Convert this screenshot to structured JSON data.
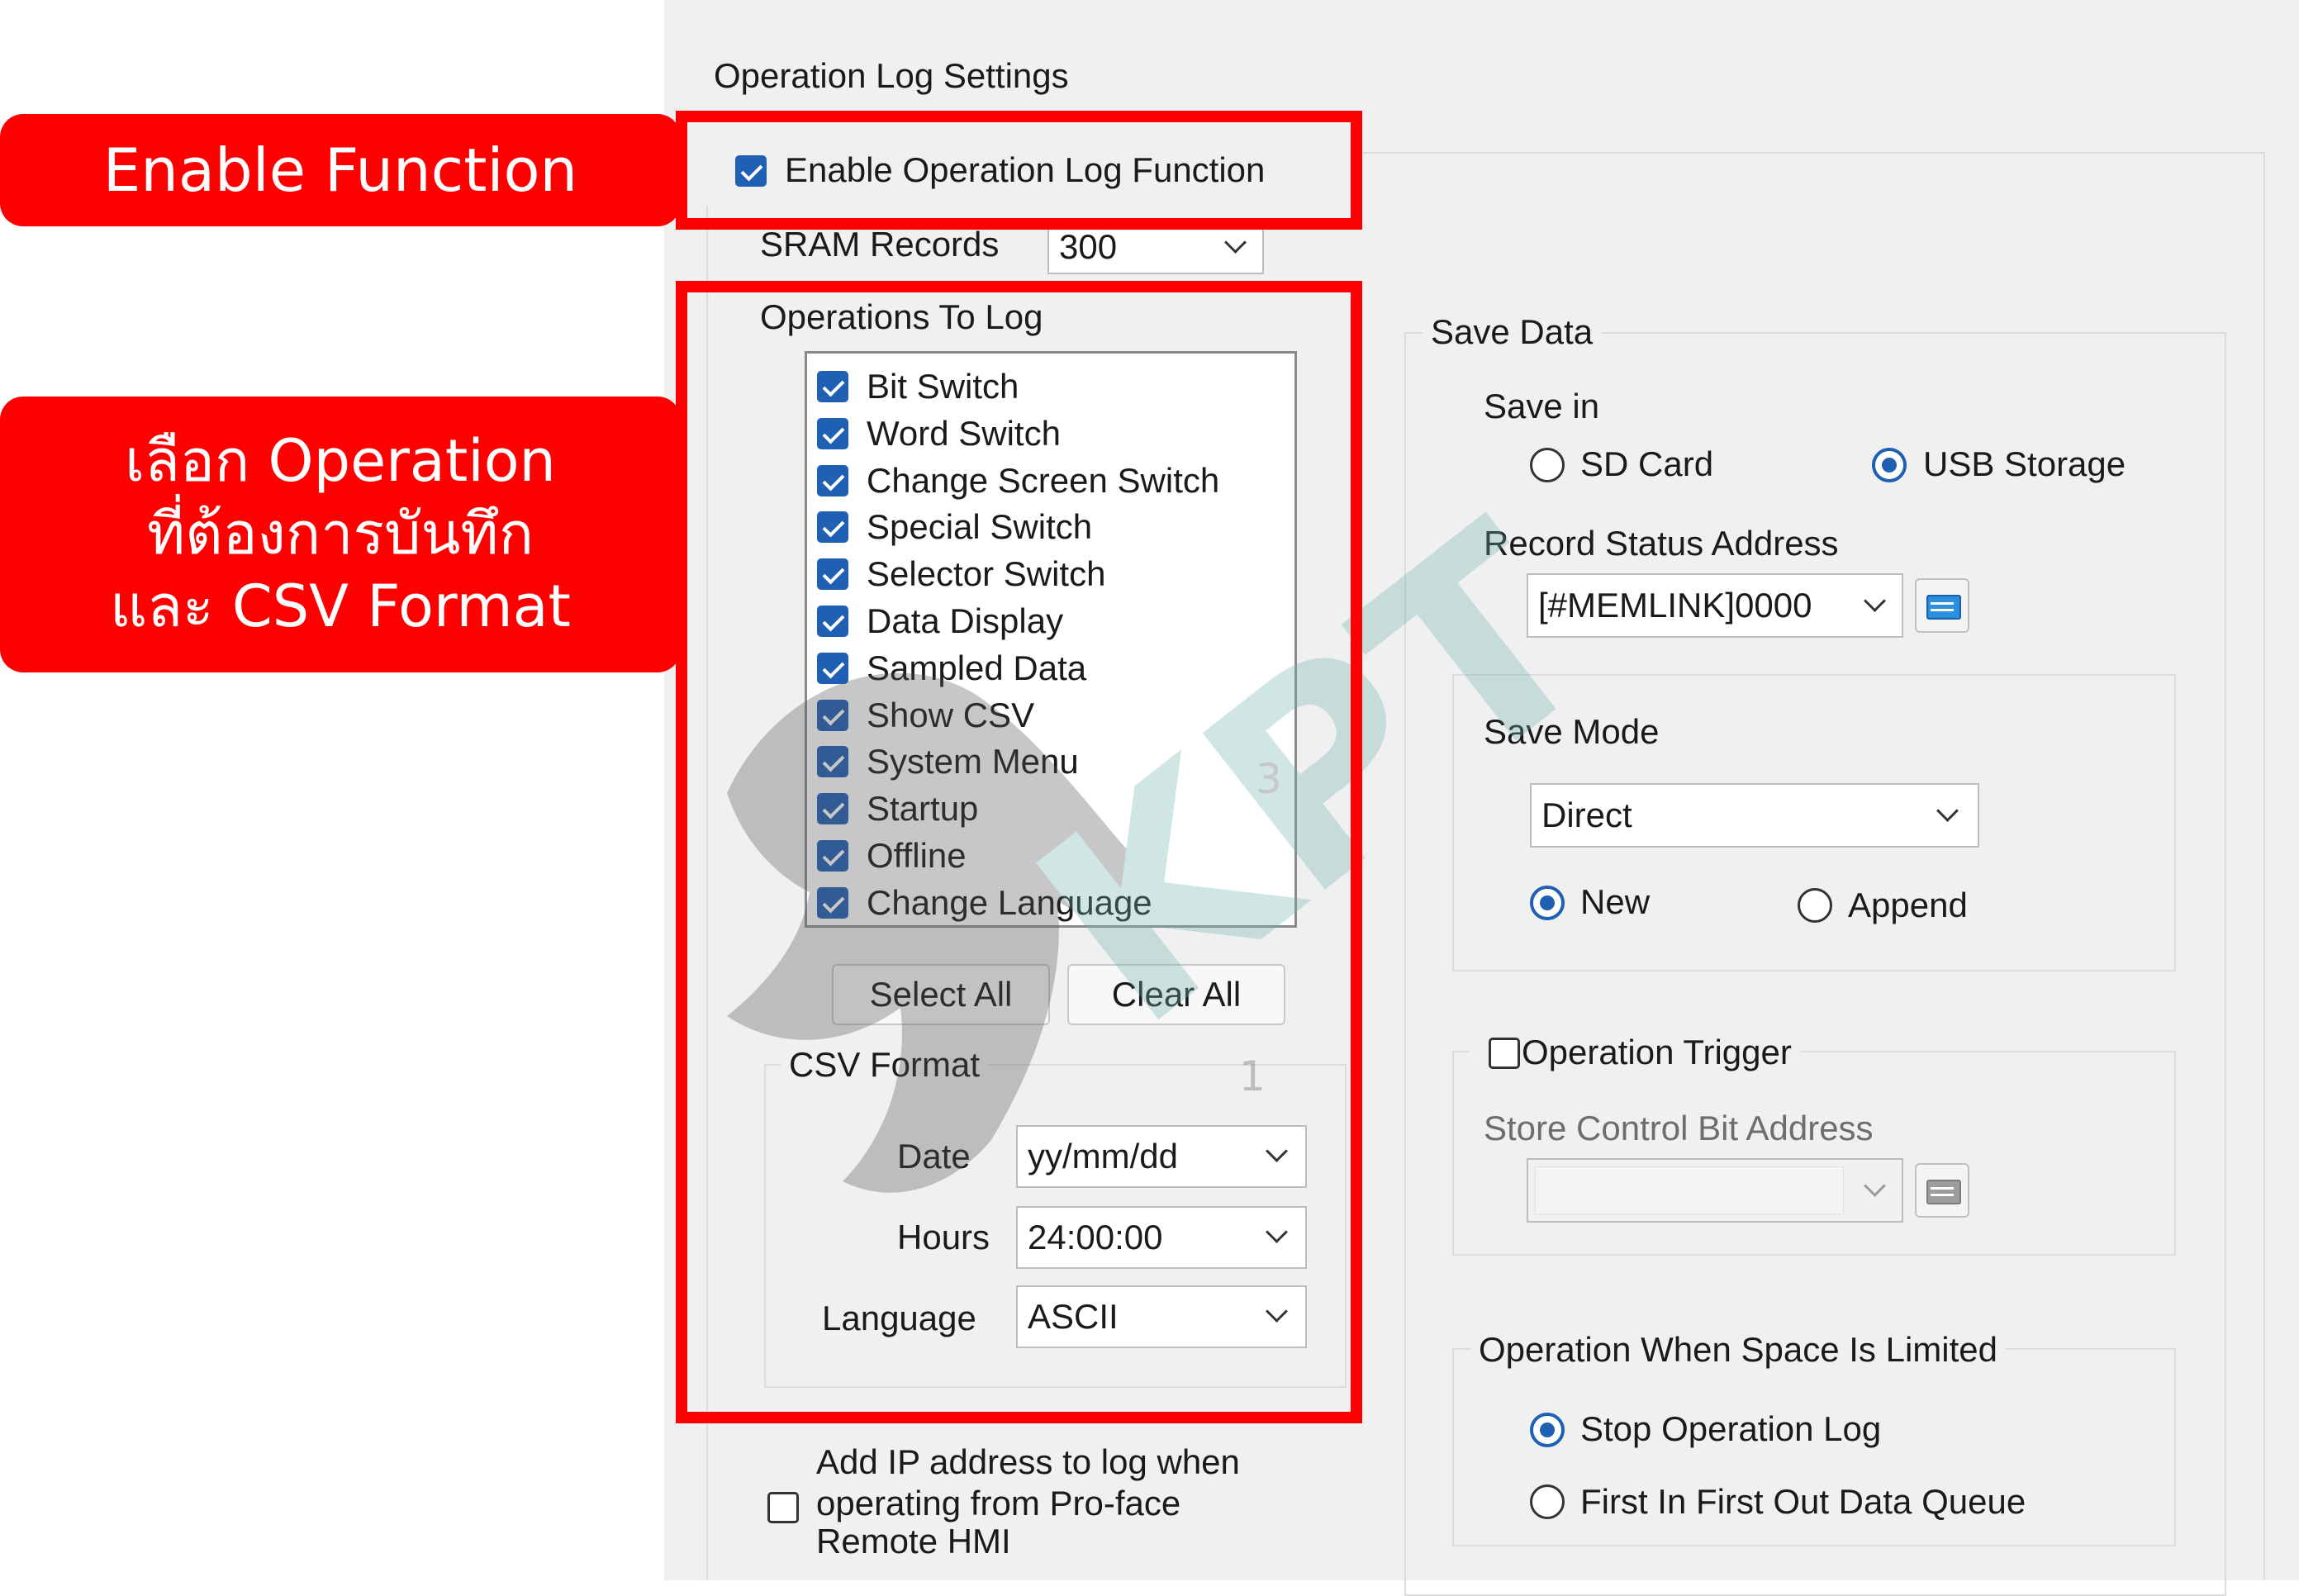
{
  "callouts": {
    "enable": "Enable Function",
    "select_lines": [
      "เลือก Operation",
      "ที่ต้องการบันทึก",
      "และ CSV Format"
    ]
  },
  "dialog": {
    "title": "Operation Log Settings",
    "enable_label": "Enable Operation Log Function",
    "enable_checked": true,
    "sram_label": "SRAM Records",
    "sram_value": "300",
    "ops_label": "Operations To Log",
    "ops": [
      {
        "label": "Bit Switch",
        "checked": true
      },
      {
        "label": "Word Switch",
        "checked": true
      },
      {
        "label": "Change Screen Switch",
        "checked": true
      },
      {
        "label": "Special Switch",
        "checked": true
      },
      {
        "label": "Selector Switch",
        "checked": true
      },
      {
        "label": "Data Display",
        "checked": true
      },
      {
        "label": "Sampled Data",
        "checked": true
      },
      {
        "label": "Show CSV",
        "checked": true
      },
      {
        "label": "System Menu",
        "checked": true
      },
      {
        "label": "Startup",
        "checked": true
      },
      {
        "label": "Offline",
        "checked": true
      },
      {
        "label": "Change Language",
        "checked": true
      }
    ],
    "select_all": "Select All",
    "clear_all": "Clear All",
    "csv": {
      "label": "CSV Format",
      "date_label": "Date",
      "date_value": "yy/mm/dd",
      "hours_label": "Hours",
      "hours_value": "24:00:00",
      "language_label": "Language",
      "language_value": "ASCII"
    },
    "ip_lines": [
      "Add IP address to log when",
      "operating from Pro-face",
      "Remote HMI"
    ],
    "ip_checked": false,
    "save": {
      "label": "Save Data",
      "save_in_label": "Save in",
      "sd_card": "SD Card",
      "usb_storage": "USB Storage",
      "selected": "USB Storage",
      "record_status_label": "Record Status Address",
      "record_status_value": "[#MEMLINK]0000",
      "save_mode_label": "Save Mode",
      "save_mode_value": "Direct",
      "new_label": "New",
      "append_label": "Append",
      "mode_selected": "New",
      "trigger_label": "Operation Trigger",
      "trigger_checked": false,
      "store_control_label": "Store Control Bit Address",
      "space_label": "Operation When Space Is Limited",
      "stop_label": "Stop Operation Log",
      "fifo_label": "First In First Out Data Queue",
      "space_selected": "Stop Operation Log"
    }
  },
  "watermark": {
    "text": "KPT",
    "digits": [
      "9",
      "1",
      "3"
    ]
  },
  "colors": {
    "accent": "#1f5fb4",
    "callout": "#ff0000",
    "dialog_bg": "#f0f0f0",
    "watermark": "#6fb3b0"
  }
}
